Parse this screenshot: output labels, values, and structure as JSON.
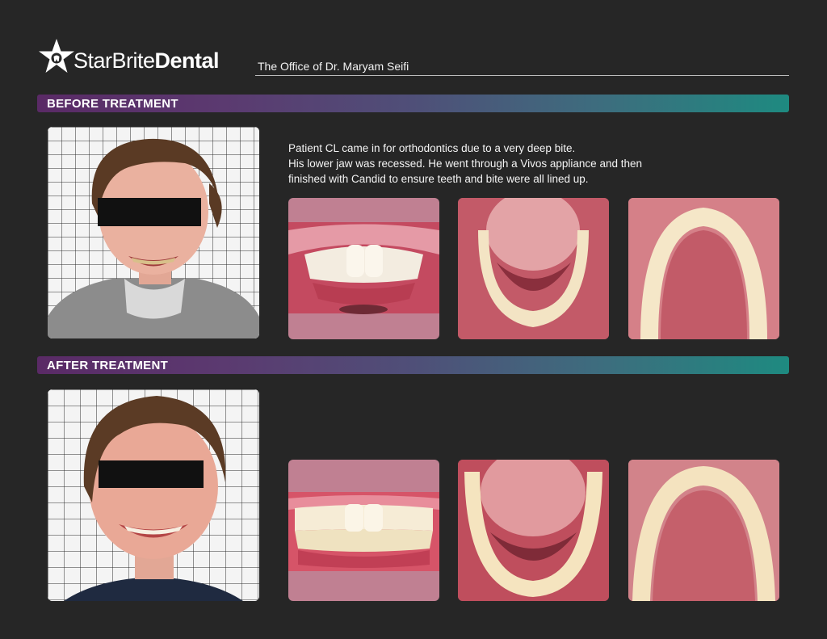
{
  "header": {
    "brand_part1": "StarBrite",
    "brand_part2": "Dental",
    "office": "The Office of Dr. Maryam Seifi"
  },
  "before": {
    "heading": "BEFORE TREATMENT",
    "description_lines": [
      "Patient CL came in for orthodontics due to a very deep bite.",
      "His lower jaw was recessed. He went through a Vivos appliance and then",
      "finished with Candid to ensure teeth and bite were all lined up."
    ]
  },
  "after": {
    "heading": "AFTER  TREATMENT"
  },
  "colors": {
    "background": "#262626",
    "band_start": "#5a2a66",
    "band_end": "#1e8a80",
    "tile_frame": "#c08092"
  }
}
